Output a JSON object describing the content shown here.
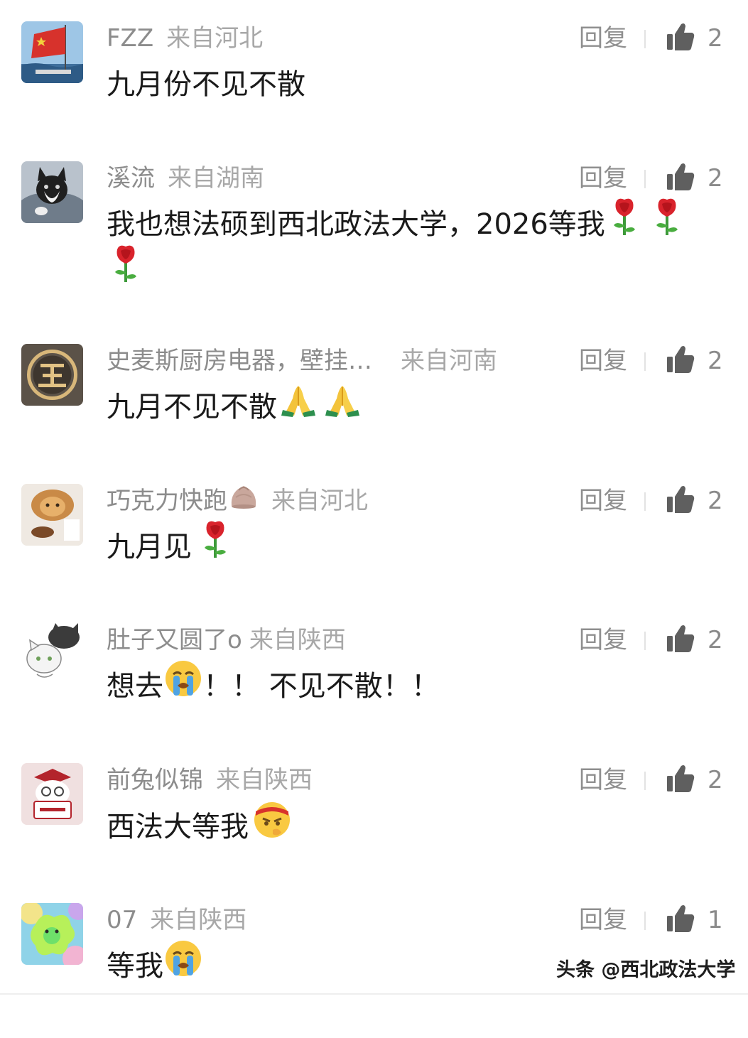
{
  "reply_label": "回复",
  "comments": [
    {
      "username": "FZZ",
      "location": "来自河北",
      "text": "九月份不见不散",
      "likes": "2",
      "avatar": "flag-on-boat",
      "emojis": []
    },
    {
      "username": "溪流",
      "location": "来自湖南",
      "text": "我也想法硕到西北政法大学，2026等我",
      "likes": "2",
      "avatar": "cat-in-hoodie",
      "emojis": [
        "rose",
        "rose",
        "rose"
      ]
    },
    {
      "username": "史麦斯厨房电器，壁挂…",
      "location": "来自河南",
      "text": "九月不见不散",
      "likes": "2",
      "avatar": "gold-wang-logo",
      "emojis": [
        "folded-hands",
        "folded-hands"
      ]
    },
    {
      "username": "巧克力快跑",
      "location": "来自河北",
      "text": "九月见",
      "likes": "2",
      "avatar": "cat-taiyaki",
      "username_emoji": "steamed-bun",
      "emojis": [
        "rose"
      ]
    },
    {
      "username": "肚子又圆了o",
      "location": "来自陕西",
      "text_before": "想去",
      "text_after": "！！ 不见不散！！",
      "likes": "2",
      "avatar": "sketch-cats",
      "emojis": [
        "loudly-crying-face"
      ]
    },
    {
      "username": "前兔似锦",
      "location": "来自陕西",
      "text": "西法大等我",
      "likes": "2",
      "avatar": "rabbit-graduate",
      "emojis": [
        "determined-face"
      ]
    },
    {
      "username": "07",
      "location": "来自陕西",
      "text": "等我",
      "likes": "1",
      "avatar": "colorful-blob",
      "emojis": [
        "loudly-crying-face"
      ]
    }
  ],
  "watermark": "头条 @西北政法大学",
  "icons": {
    "like": "thumbs-up-icon",
    "rose": "rose-emoji",
    "folded_hands": "folded-hands-emoji",
    "crying": "loudly-crying-face-emoji",
    "determined": "determined-face-emoji",
    "bun": "steamed-bun-emoji"
  },
  "colors": {
    "username": "#8c8c8c",
    "location": "#a8a8a8",
    "content": "#1a1a1a",
    "like_icon": "#5f5f5f"
  }
}
